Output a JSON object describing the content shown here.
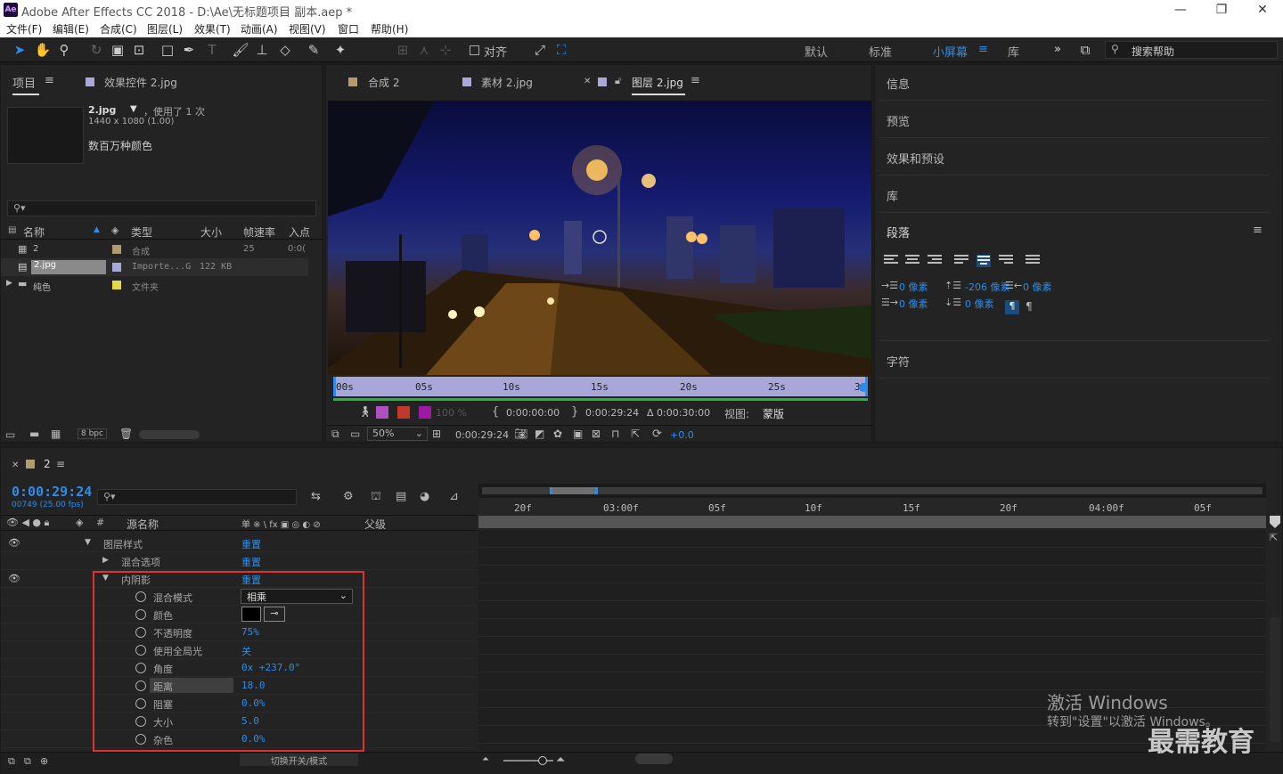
{
  "window": {
    "logo": "Ae",
    "title": "Adobe After Effects CC 2018 - D:\\Ae\\无标题项目 副本.aep *",
    "minimize": "—",
    "restore": "❐",
    "close": "✕"
  },
  "menu": [
    "文件(F)",
    "编辑(E)",
    "合成(C)",
    "图层(L)",
    "效果(T)",
    "动画(A)",
    "视图(V)",
    "窗口",
    "帮助(H)"
  ],
  "toolbar": {
    "align_label": "对齐",
    "workspaces": [
      "默认",
      "标准",
      "小屏幕",
      "库"
    ],
    "active_workspace": "小屏幕",
    "more": "»",
    "search_placeholder": "搜索帮助"
  },
  "project_panel": {
    "tab_project": "项目",
    "tab_effects": "效果控件 2.jpg",
    "item_name": "2.jpg",
    "item_used": "，使用了 1 次",
    "item_dims": "1440 x 1080 (1.00)",
    "item_color": "数百万种颜色",
    "columns": [
      "名称",
      "类型",
      "大小",
      "帧速率",
      "入点"
    ],
    "rows": [
      {
        "name": "2",
        "type": "合成",
        "size": "",
        "fps": "25",
        "in": "0:0(",
        "color": "#b29b6e"
      },
      {
        "name": "2.jpg",
        "type": "Importe...G",
        "size": "122 KB",
        "fps": "",
        "in": "",
        "color": "#a9a9d8"
      },
      {
        "name": "纯色",
        "type": "文件夹",
        "size": "",
        "fps": "",
        "in": "",
        "color": "#e4d848"
      }
    ],
    "bpc": "8 bpc"
  },
  "viewer": {
    "tabs": [
      "合成 2",
      "素材 2.jpg",
      "图层 2.jpg"
    ],
    "active_tab": "图层 2.jpg",
    "ruler": [
      "00s",
      "05s",
      "10s",
      "15s",
      "20s",
      "25s",
      "30"
    ],
    "opacity": "100 %",
    "time_in": "0:00:00:00",
    "time_out": "0:00:29:24",
    "duration": "Δ 0:00:30:00",
    "view_label": "视图:",
    "view_value": "蒙版",
    "zoom": "50%",
    "current_time": "0:00:29:24",
    "exposure": "+0.0"
  },
  "right_panels": {
    "items": [
      "信息",
      "预览",
      "效果和预设",
      "库"
    ],
    "paragraph_title": "段落",
    "indent_left": "0 像素",
    "indent_before": "-206 像素",
    "indent_right": "0 像素",
    "indent_first": "0 像素",
    "space_after": "0 像素",
    "character_title": "字符"
  },
  "timeline": {
    "tab": "2",
    "time": "0:00:29:24",
    "frames": "00749 (25.00 fps)",
    "col_source": "源名称",
    "col_parent": "父级",
    "col_switches": "单 ※ \\ fx ▣ ◎ ◐ ⊘",
    "ruler": [
      "20f",
      "03:00f",
      "05f",
      "10f",
      "15f",
      "20f",
      "04:00f",
      "05f"
    ],
    "toggle_label": "切换开关/模式",
    "layers": [
      {
        "label": "图层样式",
        "value": "重置",
        "indent": 1,
        "arrow": "▼",
        "eye": true,
        "stopwatch": false
      },
      {
        "label": "混合选项",
        "value": "重置",
        "indent": 2,
        "arrow": "▶",
        "eye": false,
        "stopwatch": false
      },
      {
        "label": "内阴影",
        "value": "重置",
        "indent": 2,
        "arrow": "▼",
        "eye": true,
        "stopwatch": false
      },
      {
        "label": "混合模式",
        "value": "相乘",
        "indent": 3,
        "arrow": "",
        "eye": false,
        "stopwatch": true,
        "dropdown": true
      },
      {
        "label": "颜色",
        "value": "",
        "indent": 3,
        "arrow": "",
        "eye": false,
        "stopwatch": true,
        "color": true
      },
      {
        "label": "不透明度",
        "value": "75%",
        "indent": 3,
        "arrow": "",
        "eye": false,
        "stopwatch": true
      },
      {
        "label": "使用全局光",
        "value": "关",
        "indent": 3,
        "arrow": "",
        "eye": false,
        "stopwatch": true
      },
      {
        "label": "角度",
        "value": "0x +237.0°",
        "indent": 3,
        "arrow": "",
        "eye": false,
        "stopwatch": true
      },
      {
        "label": "距离",
        "value": "18.0",
        "indent": 3,
        "arrow": "",
        "eye": false,
        "stopwatch": true,
        "highlight": true
      },
      {
        "label": "阻塞",
        "value": "0.0%",
        "indent": 3,
        "arrow": "",
        "eye": false,
        "stopwatch": true
      },
      {
        "label": "大小",
        "value": "5.0",
        "indent": 3,
        "arrow": "",
        "eye": false,
        "stopwatch": true
      },
      {
        "label": "杂色",
        "value": "0.0%",
        "indent": 3,
        "arrow": "",
        "eye": false,
        "stopwatch": true
      }
    ]
  },
  "watermark": {
    "activate_title": "激活 Windows",
    "activate_sub": "转到\"设置\"以激活 Windows。",
    "brand": "最需教育"
  },
  "colors": {
    "accent": "#2d8ceb",
    "highlight_box": "#e0322f",
    "panel": "#232323",
    "green_bar": "#1fb83b",
    "ruler_bar": "#a9a6d8"
  }
}
